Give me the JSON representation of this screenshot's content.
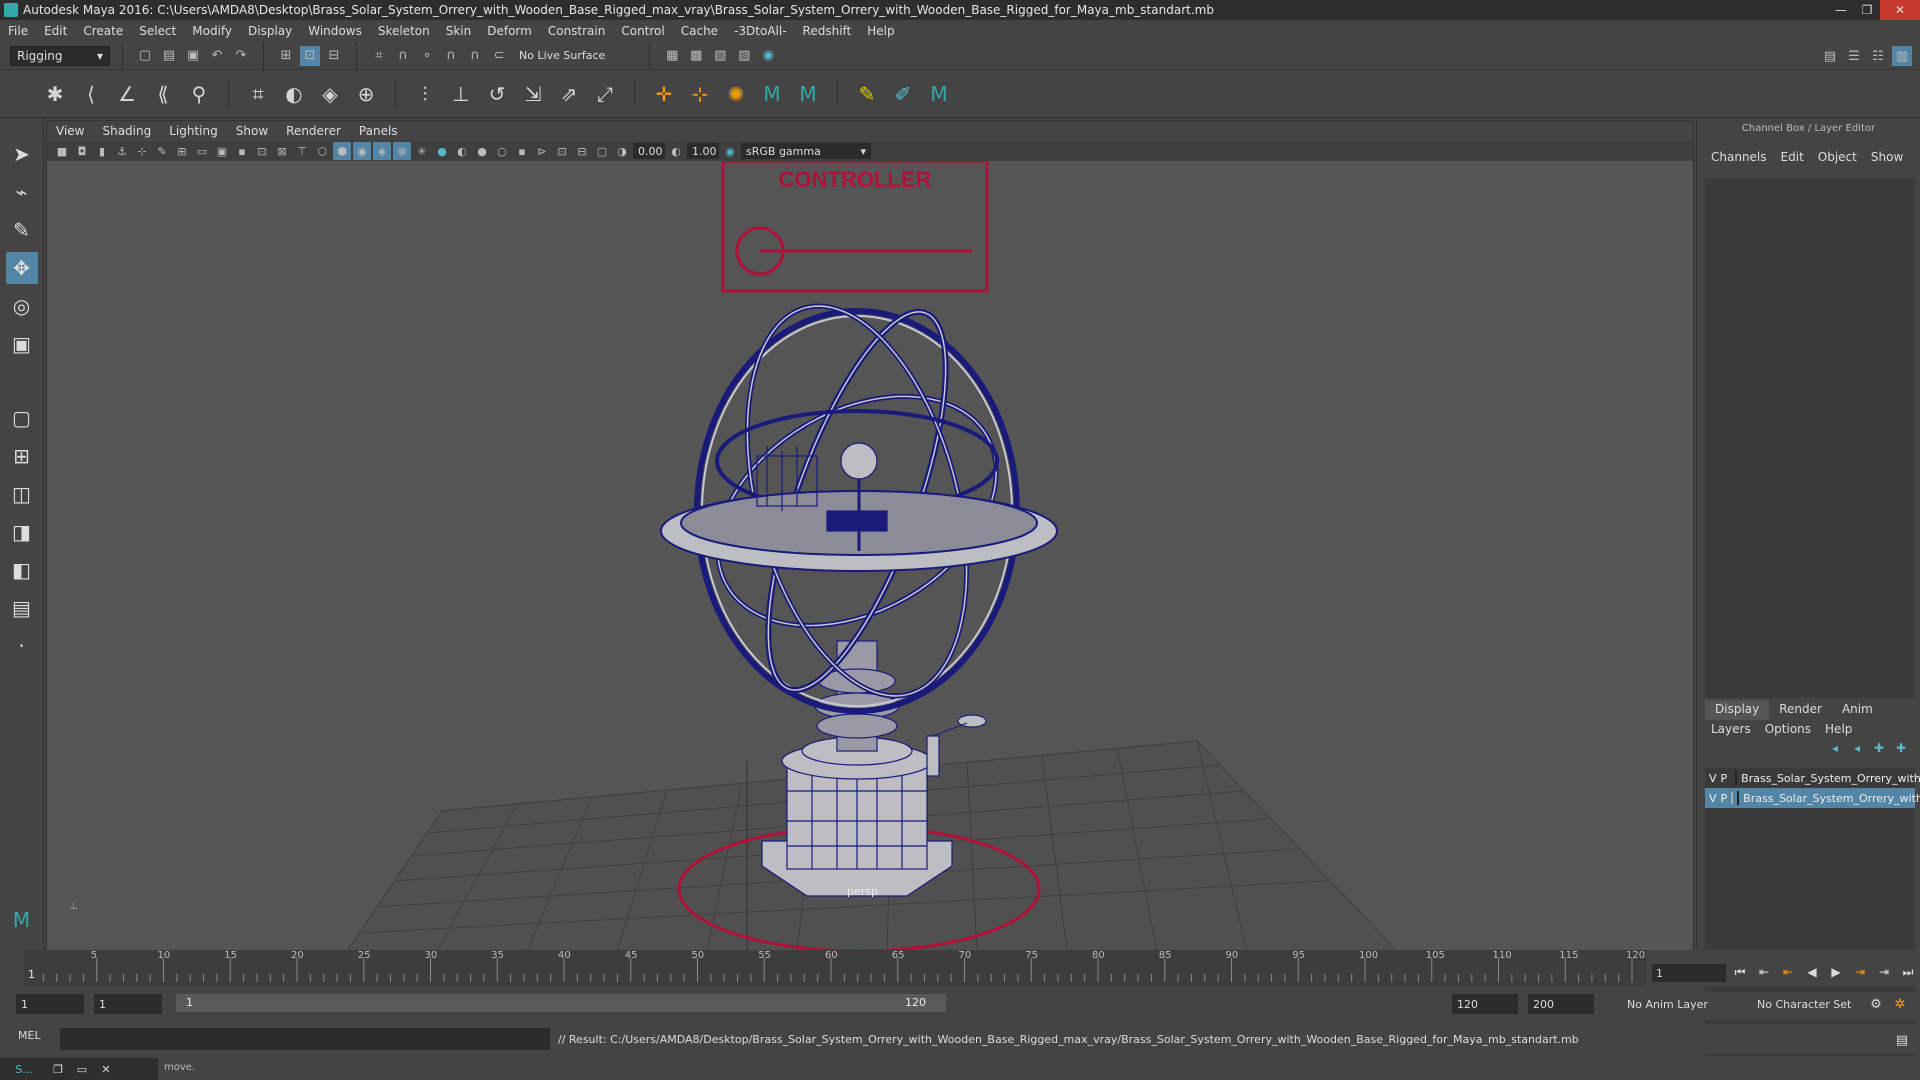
{
  "window": {
    "title": "Autodesk Maya 2016: C:\\Users\\AMDA8\\Desktop\\Brass_Solar_System_Orrery_with_Wooden_Base_Rigged_max_vray\\Brass_Solar_System_Orrery_with_Wooden_Base_Rigged_for_Maya_mb_standart.mb",
    "min": "—",
    "max": "❐",
    "close": "✕"
  },
  "menubar": [
    "File",
    "Edit",
    "Create",
    "Select",
    "Modify",
    "Display",
    "Windows",
    "Skeleton",
    "Skin",
    "Deform",
    "Constrain",
    "Control",
    "Cache",
    "-3DtoAll-",
    "Redshift",
    "Help"
  ],
  "status": {
    "menuset": "Rigging",
    "live_surface": "No Live Surface"
  },
  "viewport": {
    "menu": [
      "View",
      "Shading",
      "Lighting",
      "Show",
      "Renderer",
      "Panels"
    ],
    "field_a": "0.00",
    "field_b": "1.00",
    "color_space": "sRGB gamma",
    "camera": "persp",
    "controller_label": "CONTROLLER"
  },
  "channelbox": {
    "title": "Channel Box / Layer Editor",
    "tabs": [
      "Channels",
      "Edit",
      "Object",
      "Show"
    ]
  },
  "layer_editor": {
    "tabs": [
      "Display",
      "Render",
      "Anim"
    ],
    "menu": [
      "Layers",
      "Options",
      "Help"
    ],
    "layers": [
      {
        "v": "V",
        "p": "P",
        "name": "Brass_Solar_System_Orrery_with",
        "color": "#1a1a7a"
      },
      {
        "v": "V",
        "p": "P",
        "name": "Brass_Solar_System_Orrery_with",
        "color": "#b0103a"
      }
    ]
  },
  "timeline": {
    "ticks": [
      "5",
      "10",
      "15",
      "20",
      "25",
      "30",
      "35",
      "40",
      "45",
      "50",
      "55",
      "60",
      "65",
      "70",
      "75",
      "80",
      "85",
      "90",
      "95",
      "100",
      "105",
      "110",
      "115",
      "120"
    ],
    "start_label": "1",
    "current_frame": "1"
  },
  "range": {
    "start": "1",
    "playback_start": "1",
    "range_start_inner": "1",
    "range_end_inner": "120",
    "playback_end": "120",
    "end": "200",
    "anim_layer": "No Anim Layer",
    "character_set": "No Character Set"
  },
  "command": {
    "lang": "MEL",
    "result": "// Result: C:/Users/AMDA8/Desktop/Brass_Solar_System_Orrery_with_Wooden_Base_Rigged_max_vray/Brass_Solar_System_Orrery_with_Wooden_Base_Rigged_for_Maya_mb_standart.mb"
  },
  "help": {
    "text": "move."
  },
  "taskbar": {
    "app_label": "S..."
  }
}
